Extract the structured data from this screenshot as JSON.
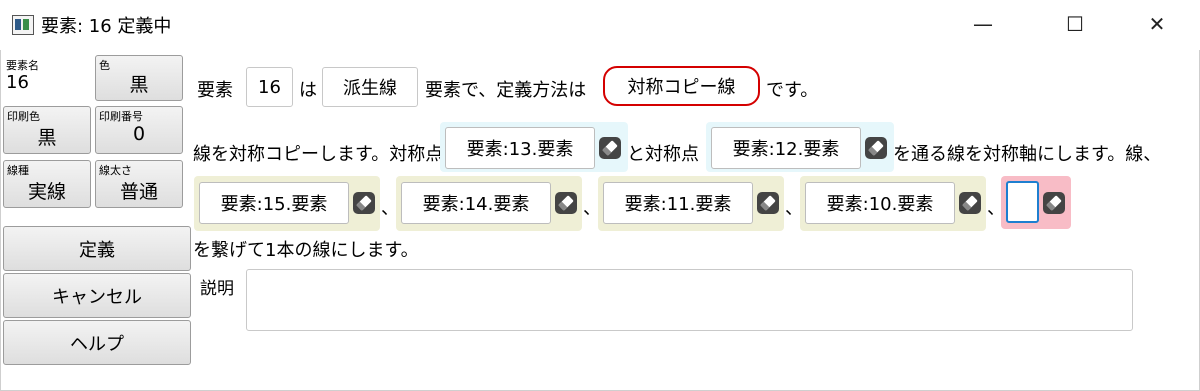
{
  "window": {
    "title": "要素: 16 定義中",
    "minimize_glyph": "—",
    "maximize_glyph": "☐",
    "close_glyph": "✕"
  },
  "left_panel": {
    "element_name_label": "要素名",
    "element_name_value": "16",
    "color_label": "色",
    "color_value": "黒",
    "print_color_label": "印刷色",
    "print_color_value": "黒",
    "print_number_label": "印刷番号",
    "print_number_value": "0",
    "line_type_label": "線種",
    "line_type_value": "実線",
    "line_width_label": "線太さ",
    "line_width_value": "普通",
    "buttons": {
      "define": "定義",
      "cancel": "キャンセル",
      "help": "ヘルプ"
    }
  },
  "sentence1": {
    "prefix": "要素",
    "element_number": "16",
    "particle": "は",
    "kind": "派生線",
    "middle": "要素で、定義方法は",
    "method": "対称コピー線",
    "suffix": "です。"
  },
  "sentence2": {
    "prefix": "線を対称コピーします。対称点",
    "point1": "要素:13.要素",
    "connector": "と対称点",
    "point2": "要素:12.要素",
    "suffix": "を通る線を対称軸にします。線、"
  },
  "line_list": {
    "items": [
      "要素:15.要素",
      "要素:14.要素",
      "要素:11.要素",
      "要素:10.要素",
      ""
    ],
    "separator": "、"
  },
  "sentence3": "を繋げて1本の線にします。",
  "description": {
    "label": "説明",
    "value": ""
  },
  "colors": {
    "cyan_group": "#e6f7fb",
    "yellow_group": "#efefd6",
    "pink_group": "#f8bcc6",
    "focus_border": "#1e7fd0",
    "method_border": "#d40000"
  }
}
